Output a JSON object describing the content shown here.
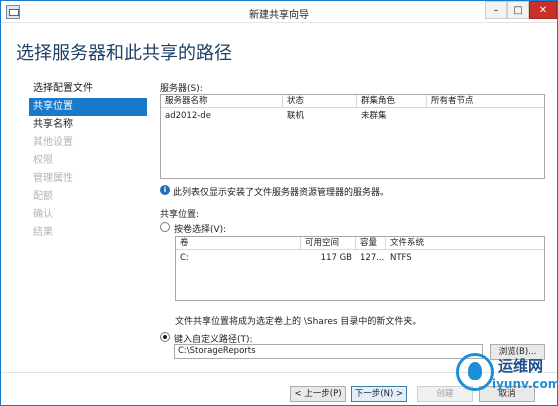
{
  "window": {
    "title": "新建共享向导",
    "controls": {
      "minimize": "–",
      "maximize": "□",
      "close": "✕"
    }
  },
  "page_title": "选择服务器和此共享的路径",
  "nav": {
    "items": [
      {
        "label": "选择配置文件",
        "state": "normal"
      },
      {
        "label": "共享位置",
        "state": "active"
      },
      {
        "label": "共享名称",
        "state": "normal"
      },
      {
        "label": "其他设置",
        "state": "disabled"
      },
      {
        "label": "权限",
        "state": "disabled"
      },
      {
        "label": "管理属性",
        "state": "disabled"
      },
      {
        "label": "配额",
        "state": "disabled"
      },
      {
        "label": "确认",
        "state": "disabled"
      },
      {
        "label": "结果",
        "state": "disabled"
      }
    ]
  },
  "servers": {
    "label": "服务器(S):",
    "columns": [
      "服务器名称",
      "状态",
      "群集角色",
      "所有者节点"
    ],
    "rows": [
      {
        "name": "ad2012-de",
        "status": "联机",
        "role": "未群集",
        "owner": ""
      }
    ],
    "info_text": "此列表仅显示安装了文件服务器资源管理器的服务器。"
  },
  "share_location": {
    "label": "共享位置:",
    "by_volume_label": "按卷选择(V):",
    "volume_columns": [
      "卷",
      "可用空间",
      "容量",
      "文件系统"
    ],
    "volumes": [
      {
        "volume": "C:",
        "free": "117 GB",
        "capacity": "127...",
        "fs": "NTFS"
      }
    ],
    "volume_note": "文件共享位置将成为选定卷上的 \\Shares 目录中的新文件夹。",
    "custom_path_label": "键入自定义路径(T):",
    "custom_path_value": "C:\\StorageReports",
    "browse_label": "浏览(B)..."
  },
  "footer": {
    "prev_label": "< 上一步(P)",
    "next_label": "下一步(N) >",
    "create_label": "创建",
    "cancel_label": "取消"
  },
  "watermark": {
    "brand": "运维网",
    "url": "iyunv.com"
  },
  "colors": {
    "accent": "#1979ca",
    "title_text": "#1e3f66",
    "close_button": "#c7312a",
    "selected_row": "#cce4f7"
  }
}
